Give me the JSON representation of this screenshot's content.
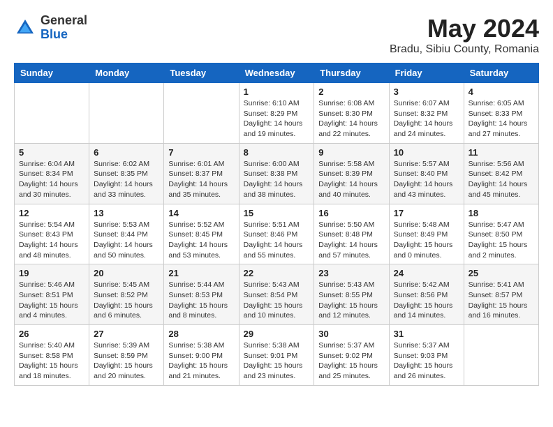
{
  "logo": {
    "general": "General",
    "blue": "Blue"
  },
  "title": "May 2024",
  "location": "Bradu, Sibiu County, Romania",
  "weekdays": [
    "Sunday",
    "Monday",
    "Tuesday",
    "Wednesday",
    "Thursday",
    "Friday",
    "Saturday"
  ],
  "weeks": [
    [
      {
        "day": "",
        "info": ""
      },
      {
        "day": "",
        "info": ""
      },
      {
        "day": "",
        "info": ""
      },
      {
        "day": "1",
        "info": "Sunrise: 6:10 AM\nSunset: 8:29 PM\nDaylight: 14 hours\nand 19 minutes."
      },
      {
        "day": "2",
        "info": "Sunrise: 6:08 AM\nSunset: 8:30 PM\nDaylight: 14 hours\nand 22 minutes."
      },
      {
        "day": "3",
        "info": "Sunrise: 6:07 AM\nSunset: 8:32 PM\nDaylight: 14 hours\nand 24 minutes."
      },
      {
        "day": "4",
        "info": "Sunrise: 6:05 AM\nSunset: 8:33 PM\nDaylight: 14 hours\nand 27 minutes."
      }
    ],
    [
      {
        "day": "5",
        "info": "Sunrise: 6:04 AM\nSunset: 8:34 PM\nDaylight: 14 hours\nand 30 minutes."
      },
      {
        "day": "6",
        "info": "Sunrise: 6:02 AM\nSunset: 8:35 PM\nDaylight: 14 hours\nand 33 minutes."
      },
      {
        "day": "7",
        "info": "Sunrise: 6:01 AM\nSunset: 8:37 PM\nDaylight: 14 hours\nand 35 minutes."
      },
      {
        "day": "8",
        "info": "Sunrise: 6:00 AM\nSunset: 8:38 PM\nDaylight: 14 hours\nand 38 minutes."
      },
      {
        "day": "9",
        "info": "Sunrise: 5:58 AM\nSunset: 8:39 PM\nDaylight: 14 hours\nand 40 minutes."
      },
      {
        "day": "10",
        "info": "Sunrise: 5:57 AM\nSunset: 8:40 PM\nDaylight: 14 hours\nand 43 minutes."
      },
      {
        "day": "11",
        "info": "Sunrise: 5:56 AM\nSunset: 8:42 PM\nDaylight: 14 hours\nand 45 minutes."
      }
    ],
    [
      {
        "day": "12",
        "info": "Sunrise: 5:54 AM\nSunset: 8:43 PM\nDaylight: 14 hours\nand 48 minutes."
      },
      {
        "day": "13",
        "info": "Sunrise: 5:53 AM\nSunset: 8:44 PM\nDaylight: 14 hours\nand 50 minutes."
      },
      {
        "day": "14",
        "info": "Sunrise: 5:52 AM\nSunset: 8:45 PM\nDaylight: 14 hours\nand 53 minutes."
      },
      {
        "day": "15",
        "info": "Sunrise: 5:51 AM\nSunset: 8:46 PM\nDaylight: 14 hours\nand 55 minutes."
      },
      {
        "day": "16",
        "info": "Sunrise: 5:50 AM\nSunset: 8:48 PM\nDaylight: 14 hours\nand 57 minutes."
      },
      {
        "day": "17",
        "info": "Sunrise: 5:48 AM\nSunset: 8:49 PM\nDaylight: 15 hours\nand 0 minutes."
      },
      {
        "day": "18",
        "info": "Sunrise: 5:47 AM\nSunset: 8:50 PM\nDaylight: 15 hours\nand 2 minutes."
      }
    ],
    [
      {
        "day": "19",
        "info": "Sunrise: 5:46 AM\nSunset: 8:51 PM\nDaylight: 15 hours\nand 4 minutes."
      },
      {
        "day": "20",
        "info": "Sunrise: 5:45 AM\nSunset: 8:52 PM\nDaylight: 15 hours\nand 6 minutes."
      },
      {
        "day": "21",
        "info": "Sunrise: 5:44 AM\nSunset: 8:53 PM\nDaylight: 15 hours\nand 8 minutes."
      },
      {
        "day": "22",
        "info": "Sunrise: 5:43 AM\nSunset: 8:54 PM\nDaylight: 15 hours\nand 10 minutes."
      },
      {
        "day": "23",
        "info": "Sunrise: 5:43 AM\nSunset: 8:55 PM\nDaylight: 15 hours\nand 12 minutes."
      },
      {
        "day": "24",
        "info": "Sunrise: 5:42 AM\nSunset: 8:56 PM\nDaylight: 15 hours\nand 14 minutes."
      },
      {
        "day": "25",
        "info": "Sunrise: 5:41 AM\nSunset: 8:57 PM\nDaylight: 15 hours\nand 16 minutes."
      }
    ],
    [
      {
        "day": "26",
        "info": "Sunrise: 5:40 AM\nSunset: 8:58 PM\nDaylight: 15 hours\nand 18 minutes."
      },
      {
        "day": "27",
        "info": "Sunrise: 5:39 AM\nSunset: 8:59 PM\nDaylight: 15 hours\nand 20 minutes."
      },
      {
        "day": "28",
        "info": "Sunrise: 5:38 AM\nSunset: 9:00 PM\nDaylight: 15 hours\nand 21 minutes."
      },
      {
        "day": "29",
        "info": "Sunrise: 5:38 AM\nSunset: 9:01 PM\nDaylight: 15 hours\nand 23 minutes."
      },
      {
        "day": "30",
        "info": "Sunrise: 5:37 AM\nSunset: 9:02 PM\nDaylight: 15 hours\nand 25 minutes."
      },
      {
        "day": "31",
        "info": "Sunrise: 5:37 AM\nSunset: 9:03 PM\nDaylight: 15 hours\nand 26 minutes."
      },
      {
        "day": "",
        "info": ""
      }
    ]
  ]
}
